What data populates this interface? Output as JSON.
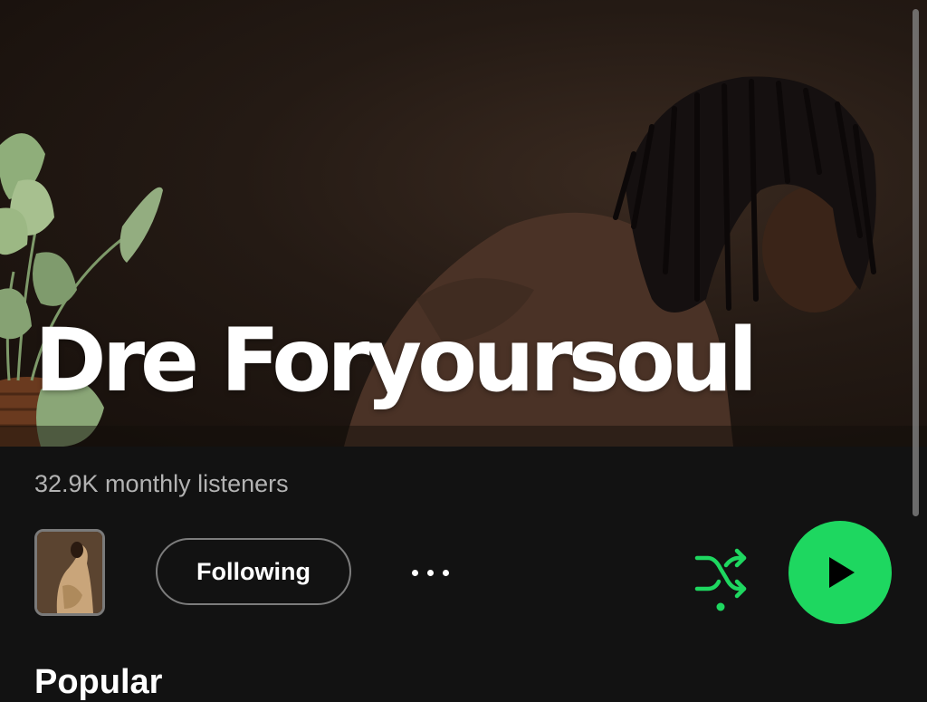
{
  "artist": {
    "name": "Dre Foryoursoul",
    "monthly_listeners": "32.9K monthly listeners"
  },
  "actions": {
    "follow_label": "Following",
    "more_icon": "more-horizontal-icon",
    "shuffle_icon": "shuffle-icon",
    "play_icon": "play-icon"
  },
  "sections": {
    "next_heading": "Popular"
  },
  "colors": {
    "background": "#121212",
    "accent": "#1ed760",
    "text_secondary": "#b3b3b3"
  }
}
